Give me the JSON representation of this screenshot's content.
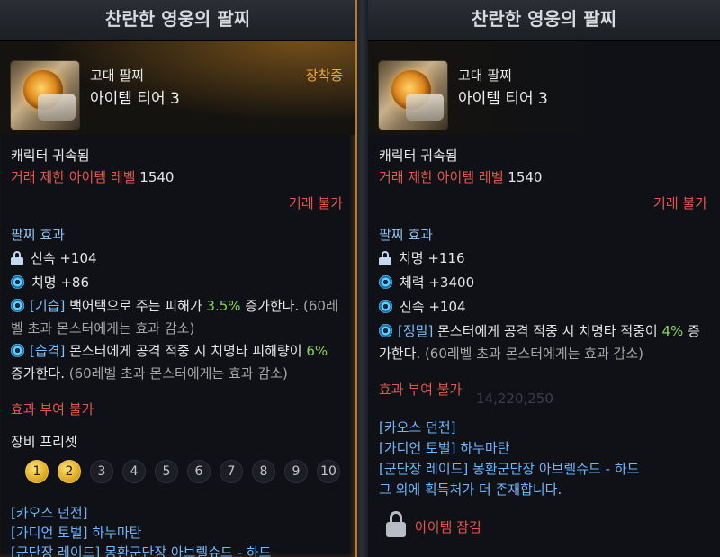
{
  "left": {
    "title": "찬란한 영웅의 팔찌",
    "grade": "고대 팔찌",
    "tier": "아이템 티어 3",
    "equipped": "장착중",
    "bound": "캐릭터 귀속됨",
    "trade_limit_label": "거래 제한 아이템 레벨",
    "trade_limit_value": "1540",
    "no_trade": "거래 불가",
    "effects_title": "팔찌 효과",
    "stats": [
      {
        "icon": "lock-icon",
        "text": "신속 +104"
      },
      {
        "icon": "swirl-icon",
        "text": "치명 +86"
      }
    ],
    "effect1": {
      "tag": "[기습]",
      "pre": "백어택으로 주는 피해가 ",
      "value": "3.5%",
      "post": " 증가한다.",
      "note": " (60레벨 초과 몬스터에게는 효과 감소)"
    },
    "effect2": {
      "tag": "[습격]",
      "pre": "몬스터에게 공격 적중 시 치명타 피해량이 ",
      "value": "6%",
      "post": " 증가한다.",
      "note": " (60레벨 초과 몬스터에게는 효과 감소)"
    },
    "no_enchant": "효과 부여 불가",
    "preset_title": "장비 프리셋",
    "presets": [
      "1",
      "2",
      "3",
      "4",
      "5",
      "6",
      "7",
      "8",
      "9",
      "10"
    ],
    "sources": [
      "[카오스 던전]",
      {
        "tag": "[가디언 토벌]",
        "name": "하누마탄"
      },
      {
        "tag": "[군단장 레이드]",
        "name": "몽환군단장 아브렐슈드 - 하드"
      }
    ]
  },
  "right": {
    "title": "찬란한 영웅의 팔찌",
    "grade": "고대 팔찌",
    "tier": "아이템 티어 3",
    "bound": "캐릭터 귀속됨",
    "trade_limit_label": "거래 제한 아이템 레벨",
    "trade_limit_value": "1540",
    "no_trade": "거래 불가",
    "effects_title": "팔찌 효과",
    "stats": [
      {
        "icon": "lock-icon",
        "text": "치명 +116"
      },
      {
        "icon": "swirl-icon",
        "text": "체력 +3400"
      },
      {
        "icon": "swirl-icon",
        "text": "신속 +104"
      }
    ],
    "effect1": {
      "tag": "[정밀]",
      "pre": "몬스터에게 공격 적중 시 치명타 적중이 ",
      "value": "4%",
      "post": " 증가한다.",
      "note": " (60레벨 초과 몬스터에게는 효과 감소)"
    },
    "no_enchant": "효과 부여 불가",
    "sources": [
      "[카오스 던전]",
      {
        "tag": "[가디언 토벌]",
        "name": "하누마탄"
      },
      {
        "tag": "[군단장 레이드]",
        "name": "몽환군단장 아브렐슈드 - 하드"
      },
      "그 외에 획득처가 더 존재합니다."
    ],
    "locked": "아이템 잠김",
    "background_number": "14,220,250"
  },
  "colors": {
    "accent": "#f1a93b",
    "red": "#e5574d",
    "link": "#6fb8ff",
    "good": "#8bd35a",
    "preset_active": "#f3d44d"
  }
}
